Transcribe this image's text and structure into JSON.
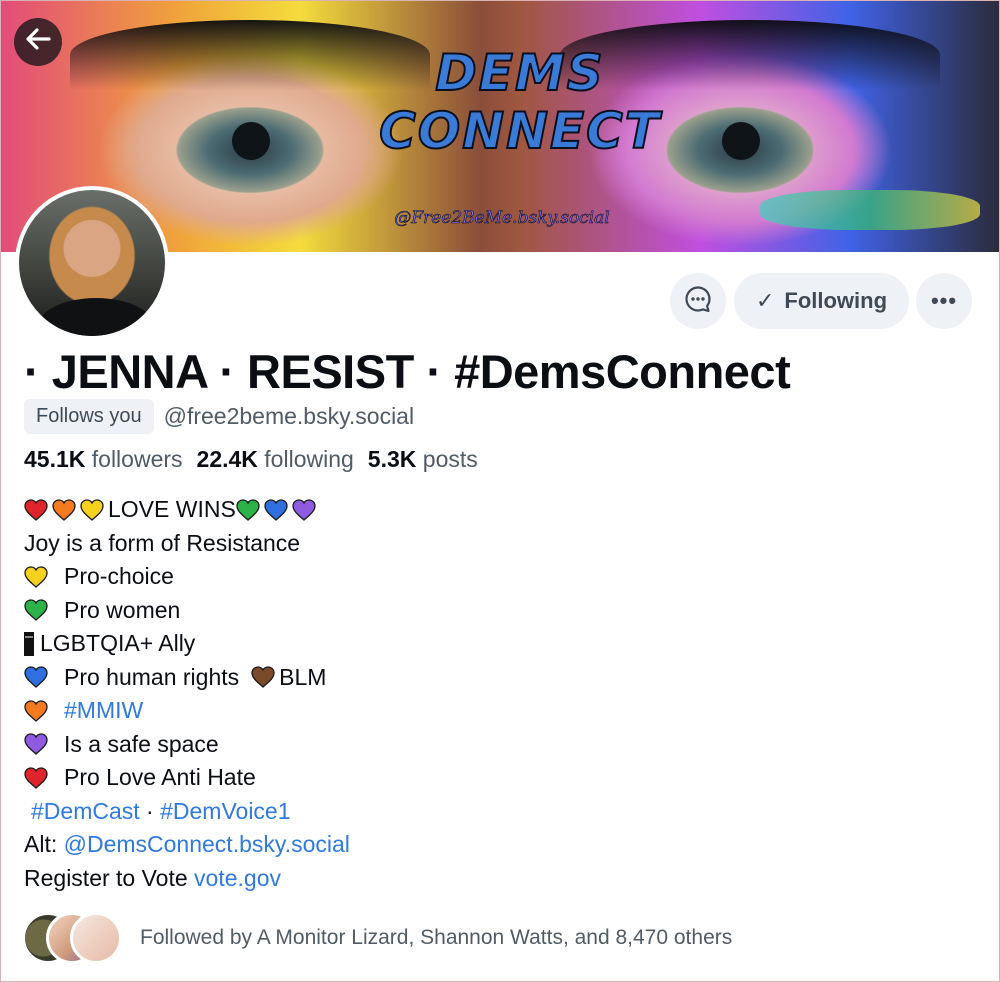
{
  "banner": {
    "title": "DEMS CONNECT",
    "handle_watermark": "@Free2BeMe.bsky.social"
  },
  "nav": {
    "back_icon": "arrow-left-icon"
  },
  "actions": {
    "message_icon": "chat-bubble-icon",
    "following_label": "Following",
    "check_glyph": "✓",
    "more_glyph": "•••"
  },
  "profile": {
    "display_name": "· JENNA · RESIST · #DemsConnect",
    "follows_you": "Follows you",
    "handle": "@free2beme.bsky.social",
    "stats": {
      "followers_count": "45.1K",
      "followers_label": "followers",
      "following_count": "22.4K",
      "following_label": "following",
      "posts_count": "5.3K",
      "posts_label": "posts"
    }
  },
  "bio": {
    "line1": "LOVE WINS",
    "line2": "Joy is a form of Resistance",
    "line3": "Pro-choice",
    "line4": "Pro women",
    "line5": "LGBTQIA+ Ally",
    "line6a": "Pro human rights",
    "line6b": "BLM",
    "line7": "#MMIW",
    "line8": "Is a safe space",
    "line9": "Pro Love Anti Hate",
    "tag1": "#DemCast",
    "tag_sep": " · ",
    "tag2": "#DemVoice1",
    "alt_label": "Alt: ",
    "alt_link": "@DemsConnect.bsky.social",
    "register_label": "Register to Vote ",
    "register_link": "vote.gov"
  },
  "followed_by": {
    "text": "Followed by A Monitor Lizard, Shannon Watts, and 8,470 others"
  },
  "colors": {
    "red": "#e0242c",
    "orange": "#f47a20",
    "yellow": "#f6d21e",
    "green": "#2bb34a",
    "blue": "#2f6fe0",
    "purple": "#8d5ae0",
    "brown": "#7a4a2a",
    "link": "#2f7ae0"
  }
}
